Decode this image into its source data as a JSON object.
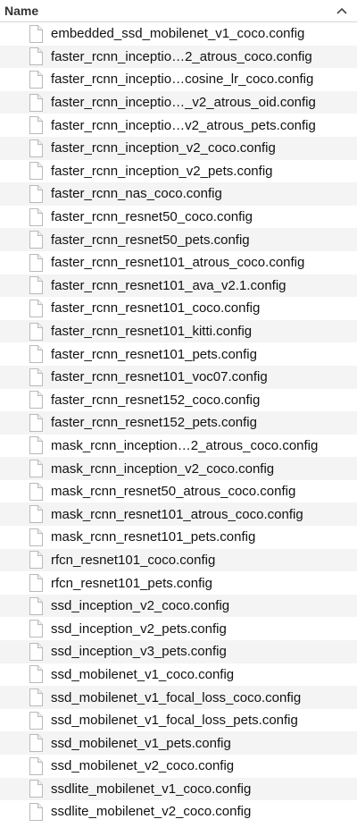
{
  "header": {
    "column_name": "Name",
    "sort_icon": "chevron-up-icon"
  },
  "files": [
    "embedded_ssd_mobilenet_v1_coco.config",
    "faster_rcnn_inceptio…2_atrous_coco.config",
    "faster_rcnn_inceptio…cosine_lr_coco.config",
    "faster_rcnn_inceptio…_v2_atrous_oid.config",
    "faster_rcnn_inceptio…v2_atrous_pets.config",
    "faster_rcnn_inception_v2_coco.config",
    "faster_rcnn_inception_v2_pets.config",
    "faster_rcnn_nas_coco.config",
    "faster_rcnn_resnet50_coco.config",
    "faster_rcnn_resnet50_pets.config",
    "faster_rcnn_resnet101_atrous_coco.config",
    "faster_rcnn_resnet101_ava_v2.1.config",
    "faster_rcnn_resnet101_coco.config",
    "faster_rcnn_resnet101_kitti.config",
    "faster_rcnn_resnet101_pets.config",
    "faster_rcnn_resnet101_voc07.config",
    "faster_rcnn_resnet152_coco.config",
    "faster_rcnn_resnet152_pets.config",
    "mask_rcnn_inception…2_atrous_coco.config",
    "mask_rcnn_inception_v2_coco.config",
    "mask_rcnn_resnet50_atrous_coco.config",
    "mask_rcnn_resnet101_atrous_coco.config",
    "mask_rcnn_resnet101_pets.config",
    "rfcn_resnet101_coco.config",
    "rfcn_resnet101_pets.config",
    "ssd_inception_v2_coco.config",
    "ssd_inception_v2_pets.config",
    "ssd_inception_v3_pets.config",
    "ssd_mobilenet_v1_coco.config",
    "ssd_mobilenet_v1_focal_loss_coco.config",
    "ssd_mobilenet_v1_focal_loss_pets.config",
    "ssd_mobilenet_v1_pets.config",
    "ssd_mobilenet_v2_coco.config",
    "ssdlite_mobilenet_v1_coco.config",
    "ssdlite_mobilenet_v2_coco.config"
  ],
  "file_icon": "document-icon",
  "colors": {
    "row_alt": "#f4f4f5",
    "header_border": "#d6d6d6",
    "text": "#111111"
  }
}
